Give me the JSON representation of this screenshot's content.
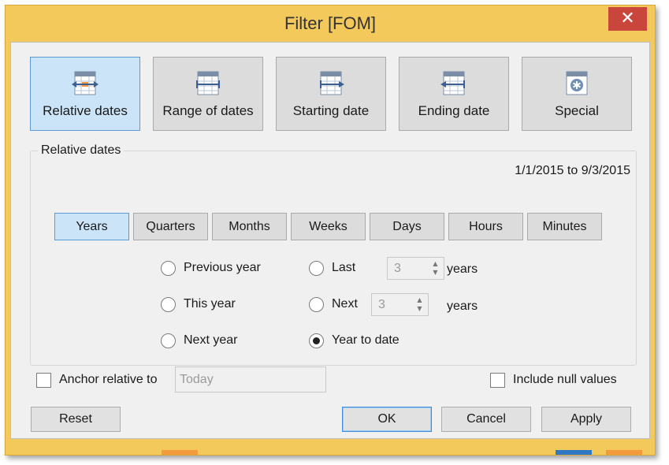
{
  "window": {
    "title": "Filter [FOM]",
    "close_glyph": "✕"
  },
  "tabs": [
    {
      "label": "Relative dates",
      "icon": "relative-dates-icon",
      "selected": true
    },
    {
      "label": "Range of dates",
      "icon": "range-of-dates-icon",
      "selected": false
    },
    {
      "label": "Starting date",
      "icon": "starting-date-icon",
      "selected": false
    },
    {
      "label": "Ending date",
      "icon": "ending-date-icon",
      "selected": false
    },
    {
      "label": "Special",
      "icon": "special-icon",
      "selected": false
    }
  ],
  "relative": {
    "group_label": "Relative dates",
    "range_text": "1/1/2015 to 9/3/2015",
    "units": [
      "Years",
      "Quarters",
      "Months",
      "Weeks",
      "Days",
      "Hours",
      "Minutes"
    ],
    "selected_unit": "Years",
    "options": {
      "previous": "Previous year",
      "this": "This year",
      "next_year": "Next year",
      "last": "Last",
      "next": "Next",
      "to_date": "Year to date"
    },
    "selected_option": "Year to date",
    "last_value": "3",
    "next_value": "3",
    "unit_suffix": "years"
  },
  "anchor": {
    "label": "Anchor relative to",
    "value": "Today",
    "checked": false
  },
  "include_null": {
    "label": "Include null values",
    "checked": false
  },
  "buttons": {
    "reset": "Reset",
    "ok": "OK",
    "cancel": "Cancel",
    "apply": "Apply"
  },
  "colors": {
    "frame": "#f4c95c",
    "selected": "#cce4f7",
    "selected_border": "#5b9bd5",
    "close": "#c9463d"
  }
}
